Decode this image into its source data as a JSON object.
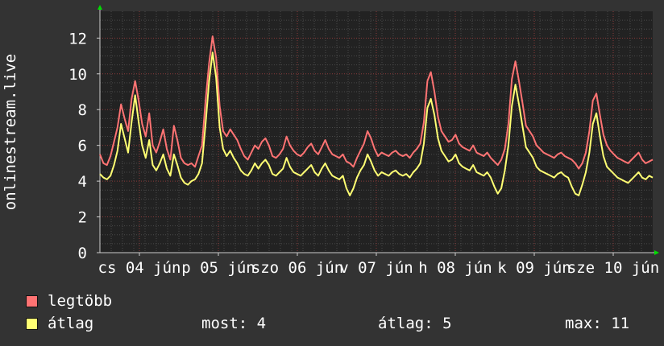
{
  "chart_data": {
    "type": "line",
    "ylabel": "onlinestream.live",
    "ylim": [
      0,
      13.5
    ],
    "yticks": [
      "0",
      "2",
      "4",
      "6",
      "8",
      "10",
      "12"
    ],
    "xticks": [
      "cs 04 jún",
      "p 05 jún",
      "szo 06 jún",
      "v 07 jún",
      "h 08 jún",
      "k 09 jún",
      "sze 10 jún"
    ],
    "grid": true,
    "series": [
      {
        "name": "legtöbb",
        "color": "#ff7373",
        "values": [
          5.5,
          5.0,
          4.9,
          5.4,
          6.2,
          7.0,
          8.3,
          7.5,
          6.8,
          8.6,
          9.6,
          8.5,
          7.2,
          6.5,
          7.8,
          6.0,
          5.6,
          6.2,
          6.9,
          5.8,
          5.2,
          7.1,
          6.3,
          5.3,
          5.0,
          4.9,
          5.0,
          4.8,
          5.4,
          6.0,
          8.5,
          10.6,
          12.1,
          10.9,
          8.2,
          6.8,
          6.5,
          6.9,
          6.6,
          6.3,
          5.8,
          5.4,
          5.2,
          5.6,
          6.0,
          5.8,
          6.2,
          6.4,
          6.0,
          5.4,
          5.3,
          5.5,
          5.8,
          6.5,
          6.0,
          5.7,
          5.5,
          5.4,
          5.6,
          5.9,
          6.1,
          5.7,
          5.5,
          5.9,
          6.3,
          5.8,
          5.5,
          5.4,
          5.3,
          5.5,
          5.1,
          5.0,
          4.8,
          5.3,
          5.7,
          6.1,
          6.8,
          6.4,
          5.8,
          5.4,
          5.6,
          5.5,
          5.4,
          5.6,
          5.7,
          5.5,
          5.4,
          5.5,
          5.3,
          5.6,
          5.8,
          6.1,
          7.3,
          9.6,
          10.1,
          9.0,
          7.6,
          6.8,
          6.5,
          6.2,
          6.3,
          6.6,
          6.1,
          5.9,
          5.8,
          5.7,
          6.0,
          5.6,
          5.5,
          5.4,
          5.6,
          5.3,
          5.1,
          4.9,
          5.2,
          5.8,
          7.2,
          9.7,
          10.7,
          9.6,
          8.4,
          7.1,
          6.8,
          6.5,
          6.0,
          5.8,
          5.6,
          5.5,
          5.4,
          5.3,
          5.5,
          5.6,
          5.4,
          5.3,
          5.2,
          5.0,
          4.7,
          5.0,
          5.6,
          6.8,
          8.5,
          8.9,
          7.7,
          6.6,
          6.0,
          5.7,
          5.5,
          5.3,
          5.2,
          5.1,
          5.0,
          5.2,
          5.4,
          5.6,
          5.2,
          5.0,
          5.1,
          5.2
        ]
      },
      {
        "name": "átlag",
        "color": "#ffff73",
        "values": [
          4.4,
          4.2,
          4.1,
          4.3,
          4.9,
          5.7,
          7.2,
          6.4,
          5.6,
          7.3,
          8.8,
          7.3,
          6.0,
          5.3,
          6.3,
          4.9,
          4.6,
          5.0,
          5.5,
          4.7,
          4.3,
          5.5,
          4.9,
          4.2,
          3.9,
          3.8,
          4.0,
          4.1,
          4.4,
          5.0,
          7.2,
          9.6,
          11.2,
          9.8,
          7.0,
          5.8,
          5.4,
          5.7,
          5.3,
          5.0,
          4.6,
          4.4,
          4.3,
          4.6,
          5.0,
          4.7,
          5.0,
          5.2,
          4.9,
          4.4,
          4.3,
          4.5,
          4.7,
          5.3,
          4.8,
          4.5,
          4.4,
          4.3,
          4.5,
          4.7,
          4.9,
          4.5,
          4.3,
          4.7,
          5.0,
          4.6,
          4.3,
          4.2,
          4.1,
          4.3,
          3.6,
          3.2,
          3.6,
          4.2,
          4.6,
          4.9,
          5.5,
          5.1,
          4.6,
          4.3,
          4.5,
          4.4,
          4.3,
          4.5,
          4.6,
          4.4,
          4.3,
          4.4,
          4.2,
          4.5,
          4.7,
          5.0,
          6.1,
          8.1,
          8.6,
          7.7,
          6.4,
          5.7,
          5.4,
          5.1,
          5.2,
          5.5,
          5.0,
          4.8,
          4.7,
          4.6,
          4.9,
          4.5,
          4.4,
          4.3,
          4.5,
          4.2,
          3.7,
          3.3,
          3.6,
          4.6,
          6.0,
          8.2,
          9.4,
          8.3,
          7.1,
          5.9,
          5.6,
          5.3,
          4.8,
          4.6,
          4.5,
          4.4,
          4.3,
          4.2,
          4.4,
          4.5,
          4.3,
          4.2,
          3.7,
          3.3,
          3.2,
          3.8,
          4.5,
          5.6,
          7.2,
          7.8,
          6.5,
          5.4,
          4.8,
          4.6,
          4.4,
          4.2,
          4.1,
          4.0,
          3.9,
          4.1,
          4.3,
          4.5,
          4.2,
          4.1,
          4.3,
          4.2
        ]
      }
    ]
  },
  "legend": [
    {
      "label": "legtöbb",
      "color": "#ff7373"
    },
    {
      "label": "átlag",
      "color": "#ffff73"
    }
  ],
  "stats": {
    "now": "most: 4",
    "avg": "átlag: 5",
    "max": "max: 11"
  }
}
